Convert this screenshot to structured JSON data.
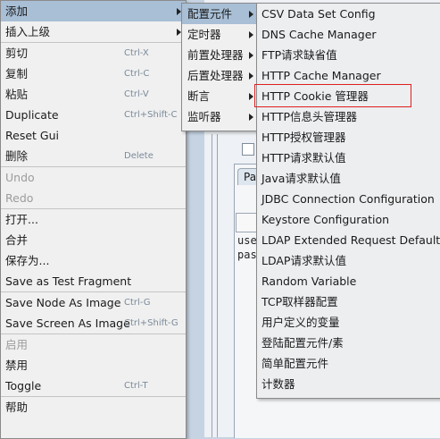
{
  "main_menu": {
    "items": [
      {
        "label": "添加",
        "shortcut": "",
        "submenu": true,
        "disabled": false,
        "highlight": true
      },
      {
        "label": "插入上级",
        "shortcut": "",
        "submenu": true,
        "disabled": false,
        "highlight": false
      },
      {
        "label": "剪切",
        "shortcut": "Ctrl-X",
        "submenu": false,
        "disabled": false,
        "highlight": false
      },
      {
        "label": "复制",
        "shortcut": "Ctrl-C",
        "submenu": false,
        "disabled": false,
        "highlight": false
      },
      {
        "label": "粘贴",
        "shortcut": "Ctrl-V",
        "submenu": false,
        "disabled": false,
        "highlight": false
      },
      {
        "label": "Duplicate",
        "shortcut": "Ctrl+Shift-C",
        "submenu": false,
        "disabled": false,
        "highlight": false
      },
      {
        "label": "Reset Gui",
        "shortcut": "",
        "submenu": false,
        "disabled": false,
        "highlight": false
      },
      {
        "label": "删除",
        "shortcut": "Delete",
        "submenu": false,
        "disabled": false,
        "highlight": false
      },
      {
        "label": "Undo",
        "shortcut": "",
        "submenu": false,
        "disabled": true,
        "highlight": false
      },
      {
        "label": "Redo",
        "shortcut": "",
        "submenu": false,
        "disabled": true,
        "highlight": false
      },
      {
        "label": "打开...",
        "shortcut": "",
        "submenu": false,
        "disabled": false,
        "highlight": false
      },
      {
        "label": "合并",
        "shortcut": "",
        "submenu": false,
        "disabled": false,
        "highlight": false
      },
      {
        "label": "保存为...",
        "shortcut": "",
        "submenu": false,
        "disabled": false,
        "highlight": false
      },
      {
        "label": "Save as Test Fragment",
        "shortcut": "",
        "submenu": false,
        "disabled": false,
        "highlight": false
      },
      {
        "label": "Save Node As Image",
        "shortcut": "Ctrl-G",
        "submenu": false,
        "disabled": false,
        "highlight": false
      },
      {
        "label": "Save Screen As Image",
        "shortcut": "Ctrl+Shift-G",
        "submenu": false,
        "disabled": false,
        "highlight": false
      },
      {
        "label": "启用",
        "shortcut": "",
        "submenu": false,
        "disabled": true,
        "highlight": false
      },
      {
        "label": "禁用",
        "shortcut": "",
        "submenu": false,
        "disabled": false,
        "highlight": false
      },
      {
        "label": "Toggle",
        "shortcut": "Ctrl-T",
        "submenu": false,
        "disabled": false,
        "highlight": false
      },
      {
        "label": "帮助",
        "shortcut": "",
        "submenu": false,
        "disabled": false,
        "highlight": false
      }
    ]
  },
  "sub_menu": {
    "items": [
      {
        "label": "配置元件",
        "highlight": true
      },
      {
        "label": "定时器",
        "highlight": false
      },
      {
        "label": "前置处理器",
        "highlight": false
      },
      {
        "label": "后置处理器",
        "highlight": false
      },
      {
        "label": "断言",
        "highlight": false
      },
      {
        "label": "监听器",
        "highlight": false
      }
    ]
  },
  "config_menu": {
    "items": [
      {
        "label": "CSV Data Set Config"
      },
      {
        "label": "DNS Cache Manager"
      },
      {
        "label": "FTP请求缺省值"
      },
      {
        "label": "HTTP Cache Manager"
      },
      {
        "label": "HTTP Cookie 管理器"
      },
      {
        "label": "HTTP信息头管理器"
      },
      {
        "label": "HTTP授权管理器"
      },
      {
        "label": "HTTP请求默认值"
      },
      {
        "label": "Java请求默认值"
      },
      {
        "label": "JDBC Connection Configuration"
      },
      {
        "label": "Keystore Configuration"
      },
      {
        "label": "LDAP Extended Request Defaults"
      },
      {
        "label": "LDAP请求默认值"
      },
      {
        "label": "Random Variable"
      },
      {
        "label": "TCP取样器配置"
      },
      {
        "label": "用户定义的变量"
      },
      {
        "label": "登陆配置元件/素"
      },
      {
        "label": "简单配置元件"
      },
      {
        "label": "计数器"
      }
    ],
    "annotated_item_index": 4,
    "annotation_color": "#e02020"
  },
  "background": {
    "tab_label": "Pa",
    "text_lines": [
      "use",
      "pas"
    ]
  },
  "colors": {
    "menu_bg": "#f0f0f0",
    "highlight_bg": "#a8bfd6",
    "disabled_text": "#9c9c9c",
    "shortcut_text": "#7a8a9a"
  }
}
